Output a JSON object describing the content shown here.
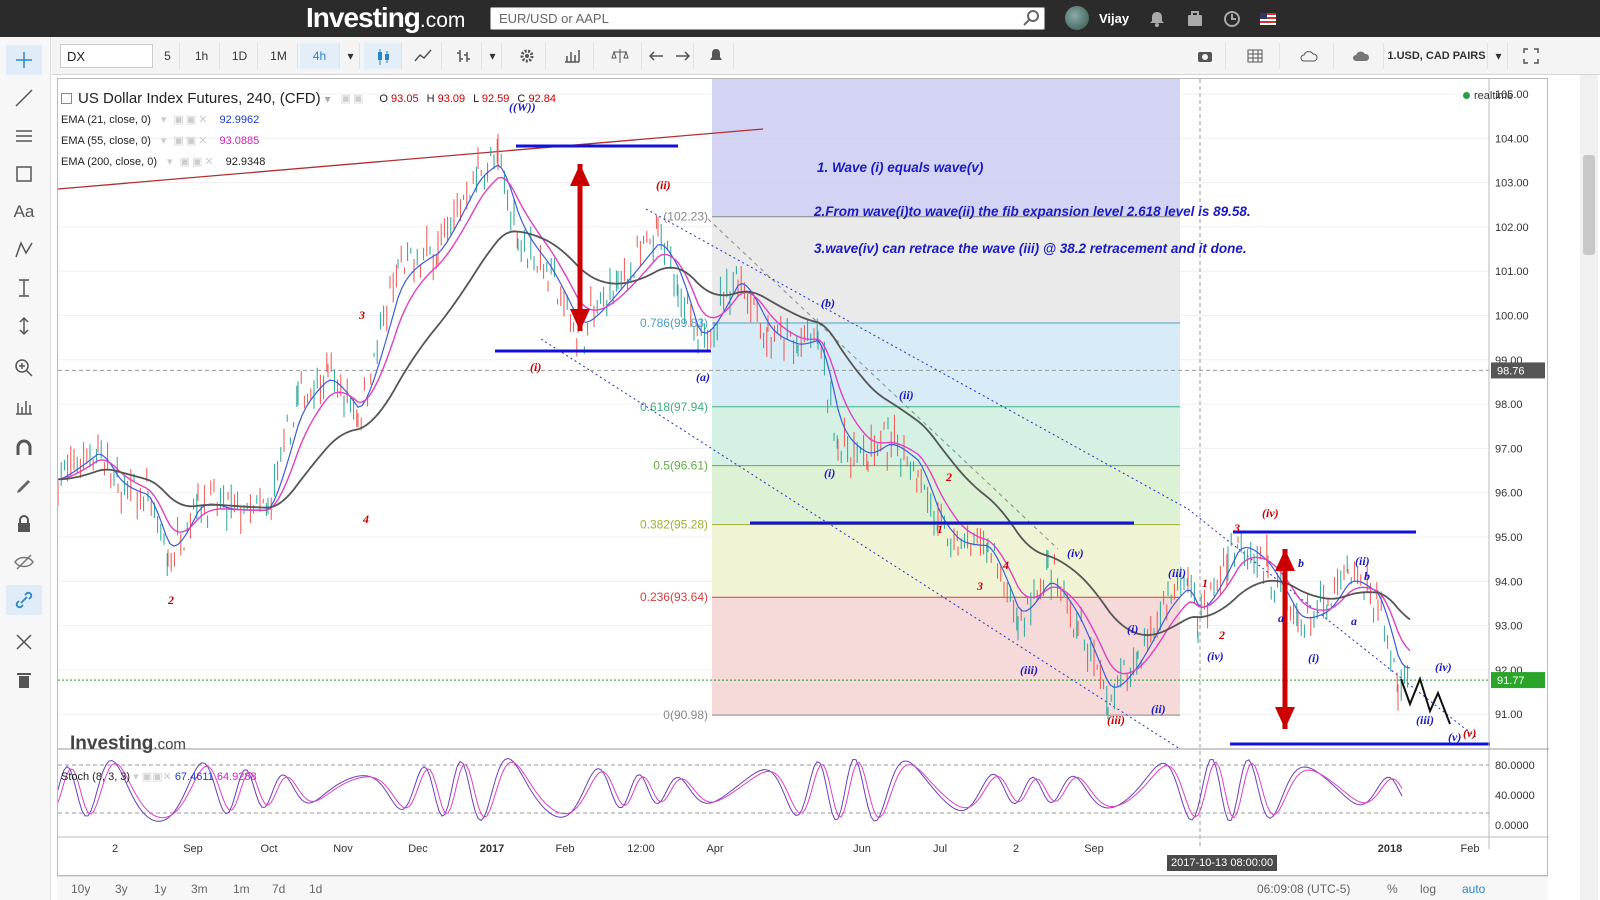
{
  "header": {
    "brand": "Investing",
    "brand_suffix": ".com",
    "search_placeholder": "EUR/USD or AAPL",
    "username": "Vijay"
  },
  "toolbar": {
    "symbol": "DX",
    "intervals": [
      "5",
      "1h",
      "1D",
      "1M",
      "4h"
    ],
    "selected_interval": "4h",
    "watchlist": "1.USD, CAD PAIRS"
  },
  "legend": {
    "title": "US Dollar Index Futures, 240, (CFD)",
    "open_label": "O",
    "open": "93.05",
    "high_label": "H",
    "high": "93.09",
    "low_label": "L",
    "low": "92.59",
    "close_label": "C",
    "close": "92.84",
    "ema21_label": "EMA (21, close, 0)",
    "ema21_value": "92.9962",
    "ema55_label": "EMA (55, close, 0)",
    "ema55_value": "93.0885",
    "ema200_label": "EMA (200, close, 0)",
    "ema200_value": "92.9348",
    "realtime": "realtime",
    "stoch_label": "Stoch (8, 3, 3)",
    "stoch_k": "67.4611",
    "stoch_d": "64.9288"
  },
  "watermark": {
    "brand": "Investing",
    "suffix": ".com"
  },
  "notes": [
    "1. Wave (i) equals wave(v)",
    "2.From wave(i)to wave(ii) the fib expansion level 2.618 level is 89.58.",
    "3.wave(iv) can retrace the wave (iii) @ 38.2 retracement and it done."
  ],
  "colors": {
    "price_up": "#26a69a",
    "price_down": "#ef5350",
    "ema21": "#3b5bdb",
    "ema55": "#e040c0",
    "ema200": "#555555",
    "annotation_blue": "#1b1bbf",
    "annotation_red": "#cc0000",
    "fib_blue_zone": "#c8c8f0",
    "fib_grey_zone": "#e6e6e6"
  },
  "fib_levels": [
    {
      "label": "(102.23)",
      "value": 102.23,
      "color": "#888888",
      "fill": "#e6e6e6"
    },
    {
      "label": "0.786(99.83)",
      "value": 99.83,
      "color": "#4ca0cc",
      "fill": "#d0e9f5"
    },
    {
      "label": "0.618(97.94)",
      "value": 97.94,
      "color": "#40b080",
      "fill": "#cdeede"
    },
    {
      "label": "0.5(96.61)",
      "value": 96.61,
      "color": "#60b040",
      "fill": "#d7efcd"
    },
    {
      "label": "0.382(95.28)",
      "value": 95.28,
      "color": "#a0b030",
      "fill": "#eef2cd"
    },
    {
      "label": "0.236(93.64)",
      "value": 93.64,
      "color": "#d04040",
      "fill": "#f5d2d2"
    },
    {
      "label": "0(90.98)",
      "value": 90.98,
      "color": "#888888",
      "fill": "#f5d2d2"
    }
  ],
  "price_axis": {
    "ticks": [
      "105.00",
      "104.00",
      "103.00",
      "102.00",
      "101.00",
      "100.00",
      "99.00",
      "98.00",
      "97.00",
      "96.00",
      "95.00",
      "94.00",
      "93.00",
      "92.00",
      "91.00"
    ],
    "crosshair_price": "98.76",
    "last_price": "91.77"
  },
  "stoch_axis": {
    "ticks": [
      "80.0000",
      "40.0000",
      "0.0000"
    ]
  },
  "time_axis": {
    "labels": [
      "2",
      "Sep",
      "Oct",
      "Nov",
      "Dec",
      "2017",
      "Feb",
      "12:00",
      "Apr",
      "Jun",
      "Jul",
      "2",
      "Sep",
      "2018",
      "Feb"
    ],
    "crosshair_time": "2017-10-13 08:00:00"
  },
  "wave_labels": [
    {
      "text": "((W))",
      "color": "blue"
    },
    {
      "text": "(ii)",
      "color": "red"
    },
    {
      "text": "(i)",
      "color": "red"
    },
    {
      "text": "(a)",
      "color": "blue"
    },
    {
      "text": "(b)",
      "color": "blue"
    },
    {
      "text": "(ii)",
      "color": "blue"
    },
    {
      "text": "(i)",
      "color": "blue"
    },
    {
      "text": "2",
      "color": "red"
    },
    {
      "text": "1",
      "color": "red"
    },
    {
      "text": "(iv)",
      "color": "blue"
    },
    {
      "text": "4",
      "color": "red"
    },
    {
      "text": "3",
      "color": "red"
    },
    {
      "text": "(iii)",
      "color": "blue"
    },
    {
      "text": "(iii)",
      "color": "red"
    },
    {
      "text": "(ii)",
      "color": "blue"
    },
    {
      "text": "(i)",
      "color": "blue"
    },
    {
      "text": "(iii)",
      "color": "blue"
    },
    {
      "text": "(iv)",
      "color": "blue"
    },
    {
      "text": "1",
      "color": "red"
    },
    {
      "text": "2",
      "color": "red"
    },
    {
      "text": "3",
      "color": "red"
    },
    {
      "text": "(iv)",
      "color": "red"
    },
    {
      "text": "b",
      "color": "blue"
    },
    {
      "text": "a",
      "color": "blue"
    },
    {
      "text": "(i)",
      "color": "blue"
    },
    {
      "text": "(ii)",
      "color": "blue"
    },
    {
      "text": "b",
      "color": "blue"
    },
    {
      "text": "a",
      "color": "blue"
    },
    {
      "text": "(iv)",
      "color": "blue"
    },
    {
      "text": "(iii)",
      "color": "blue"
    },
    {
      "text": "(v)",
      "color": "red"
    },
    {
      "text": "(v)",
      "color": "blue"
    },
    {
      "text": "3",
      "color": "red"
    },
    {
      "text": "4",
      "color": "red"
    },
    {
      "text": "2",
      "color": "red"
    }
  ],
  "bottom": {
    "ranges": [
      "10y",
      "3y",
      "1y",
      "3m",
      "1m",
      "7d",
      "1d"
    ],
    "clock": "06:09:08 (UTC-5)",
    "percent": "%",
    "log": "log",
    "auto": "auto"
  }
}
